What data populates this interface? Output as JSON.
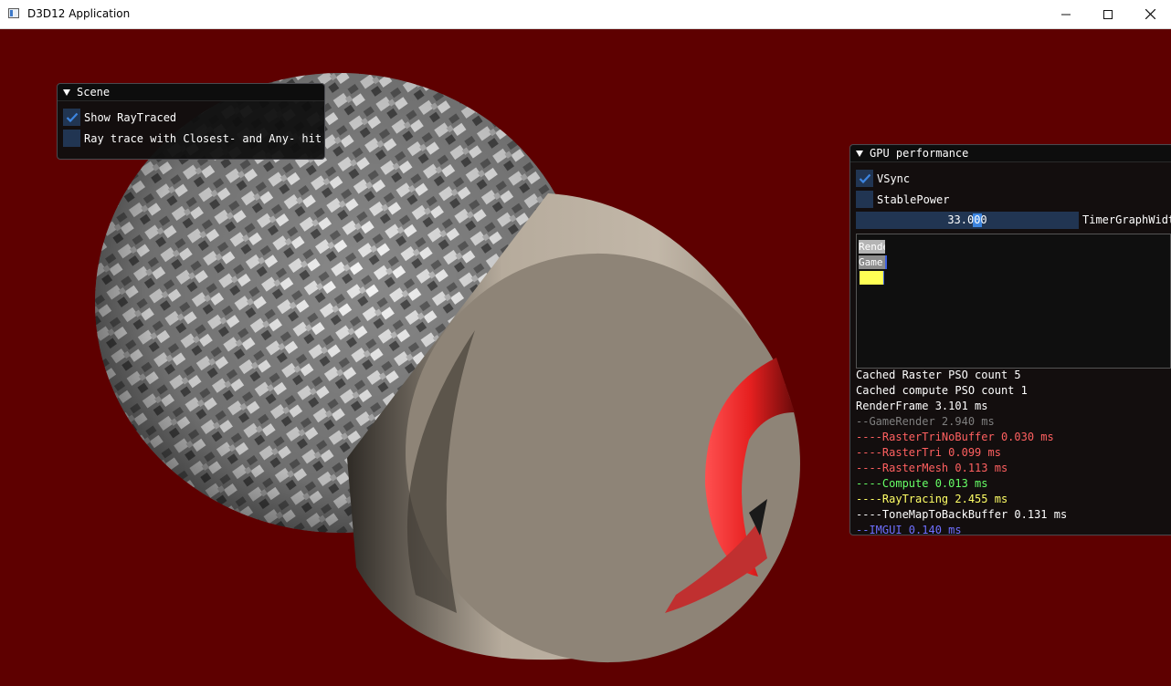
{
  "window": {
    "title": "D3D12 Application"
  },
  "scene_panel": {
    "title": "Scene",
    "show_raytraced": {
      "label": "Show RayTraced",
      "checked": true
    },
    "closest_any_hit": {
      "label": "Ray trace with Closest- and Any- hit",
      "checked": false
    }
  },
  "gpu_panel": {
    "title": "GPU performance",
    "vsync": {
      "label": "VSync",
      "checked": true
    },
    "stablepower": {
      "label": "StablePower",
      "checked": false
    },
    "slider": {
      "value": "33.000",
      "label": "TimerGraphWidt"
    },
    "graph_bars": [
      {
        "label": "Rende",
        "color": "#b4b4b4"
      },
      {
        "label": "Game",
        "color": "#8c8c8c"
      },
      {
        "label": "",
        "color": "#ffff55"
      }
    ],
    "stats": [
      {
        "text": "Cached Raster  PSO count 5",
        "color": "#ffffff"
      },
      {
        "text": "Cached compute PSO count 1",
        "color": "#ffffff"
      },
      {
        "text": "RenderFrame 3.101 ms",
        "color": "#ffffff"
      },
      {
        "text": "--GameRender 2.940 ms",
        "color": "#7f7f7f"
      },
      {
        "text": "----RasterTriNoBuffer 0.030 ms",
        "color": "#ff6060"
      },
      {
        "text": "----RasterTri 0.099 ms",
        "color": "#ff6060"
      },
      {
        "text": "----RasterMesh 0.113 ms",
        "color": "#ff6060"
      },
      {
        "text": "----Compute 0.013 ms",
        "color": "#66ff66"
      },
      {
        "text": "----RayTracing 2.455 ms",
        "color": "#ffff66"
      },
      {
        "text": "----ToneMapToBackBuffer 0.131 ms",
        "color": "#ffffff"
      },
      {
        "text": "--IMGUI 0.140 ms",
        "color": "#6f6fff"
      }
    ]
  },
  "colors": {
    "background": "#5e0000",
    "checkbox": "#213552",
    "accent": "#3d85e0"
  }
}
